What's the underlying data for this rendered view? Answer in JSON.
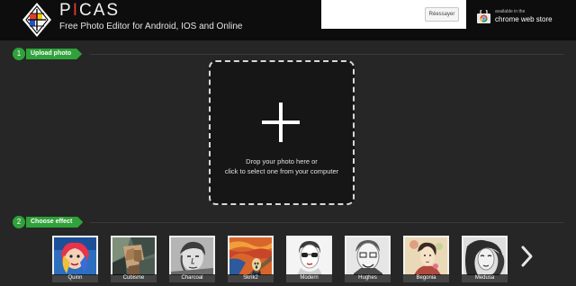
{
  "header": {
    "brand_first": "P",
    "brand_accent": "I",
    "brand_rest": "CAS",
    "tagline": "Free Photo Editor for Android, IOS and Online",
    "ad_retry_label": "Réessayer",
    "chrome_store_small": "available in the",
    "chrome_store_big": "chrome web store"
  },
  "steps": [
    {
      "number": "1",
      "label": "Upload photo"
    },
    {
      "number": "2",
      "label": "Choose effect"
    }
  ],
  "upload": {
    "line1": "Drop your photo here or",
    "line2": "click to select one from your computer"
  },
  "effects": [
    {
      "name": "Quinn"
    },
    {
      "name": "Cubisme"
    },
    {
      "name": "Charcoal"
    },
    {
      "name": "Skrik2"
    },
    {
      "name": "Modern"
    },
    {
      "name": "Hughes"
    },
    {
      "name": "Begonia"
    },
    {
      "name": "Medusa"
    }
  ],
  "colors": {
    "background": "#262626",
    "header": "#0d0d0d",
    "accent_green": "#2fa23a",
    "brand_red": "#e73a2f"
  }
}
